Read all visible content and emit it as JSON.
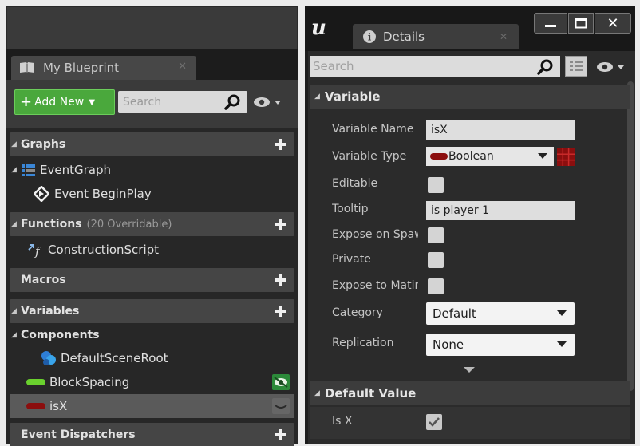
{
  "my_blueprint": {
    "tab_label": "My Blueprint",
    "toolbar": {
      "add_new_label": "Add New",
      "search_placeholder": "Search"
    },
    "sections": {
      "graphs": {
        "label": "Graphs",
        "items": [
          {
            "label": "EventGraph"
          },
          {
            "label": "Event BeginPlay"
          }
        ]
      },
      "functions": {
        "label": "Functions",
        "overridable": "(20 Overridable)",
        "items": [
          {
            "label": "ConstructionScript"
          }
        ]
      },
      "macros": {
        "label": "Macros"
      },
      "variables": {
        "label": "Variables"
      },
      "components": {
        "label": "Components",
        "items": [
          {
            "label": "DefaultSceneRoot"
          }
        ]
      },
      "variable_items": [
        {
          "label": "BlockSpacing",
          "color": "#6ad12e"
        },
        {
          "label": "isX",
          "color": "#8b0e0e",
          "selected": true
        }
      ],
      "event_dispatchers": {
        "label": "Event Dispatchers"
      }
    }
  },
  "details": {
    "tab_label": "Details",
    "search_placeholder": "Search",
    "variable_section": {
      "label": "Variable",
      "properties": {
        "variable_name": {
          "label": "Variable Name",
          "value": "isX"
        },
        "variable_type": {
          "label": "Variable Type",
          "value": "Boolean",
          "color": "#8b0e0e"
        },
        "editable": {
          "label": "Editable"
        },
        "tooltip": {
          "label": "Tooltip",
          "value": "is player 1"
        },
        "expose_on_spawn": {
          "label": "Expose on Spawn"
        },
        "private": {
          "label": "Private"
        },
        "expose_to_matinee": {
          "label": "Expose to Matinee"
        },
        "category": {
          "label": "Category",
          "value": "Default"
        },
        "replication": {
          "label": "Replication",
          "value": "None"
        }
      }
    },
    "default_value_section": {
      "label": "Default Value",
      "properties": {
        "is_x": {
          "label": "Is X",
          "checked": true
        }
      }
    }
  },
  "colors": {
    "accent_green": "#4aa83c",
    "boolean_red": "#8b0e0e",
    "float_green": "#6ad12e"
  }
}
